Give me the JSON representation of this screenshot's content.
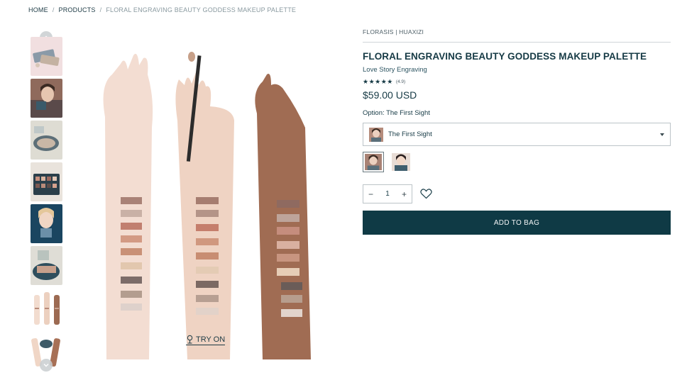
{
  "breadcrumb": {
    "home": "HOME",
    "products": "PRODUCTS",
    "current": "FLORAL ENGRAVING BEAUTY GODDESS MAKEUP PALETTE",
    "separator": "/"
  },
  "gallery": {
    "thumbnail_count": 8,
    "try_on_label": "TRY ON"
  },
  "product": {
    "brand": "FLORASIS | HUAXIZI",
    "title": "FLORAL ENGRAVING BEAUTY GODDESS MAKEUP PALETTE",
    "subtitle": "Love Story Engraving",
    "stars": "★★★★★",
    "rating": "(4.9)",
    "price": "$59.00 USD",
    "option_label": "Option: The First Sight",
    "selected_option": "The First Sight",
    "quantity": "1",
    "minus": "−",
    "plus": "+",
    "add_to_bag": "ADD TO BAG"
  },
  "colors": {
    "primary": "#0f3a45",
    "text": "#163a45",
    "border": "#bcc4c8"
  }
}
